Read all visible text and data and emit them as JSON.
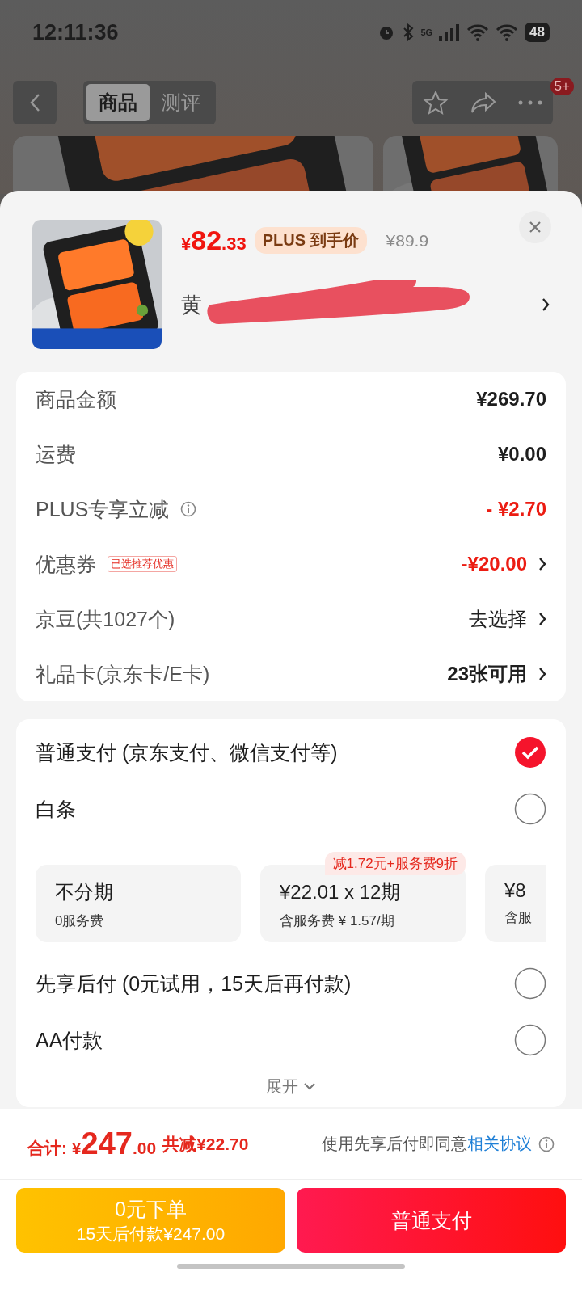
{
  "status_bar": {
    "time": "12:11:36",
    "network": "5G",
    "battery": "48"
  },
  "nav": {
    "tabs": [
      {
        "label": "商品",
        "selected": true
      },
      {
        "label": "测评",
        "selected": false
      }
    ],
    "badge": "5+"
  },
  "product": {
    "price_symbol": "¥",
    "price_int": "82",
    "price_dec": ".33",
    "plus_tag": "PLUS 到手价",
    "original_price": "¥89.9",
    "name": "黄"
  },
  "summary": [
    {
      "label": "商品金额",
      "value": "¥269.70",
      "kind": "amount",
      "arrow": false,
      "info": false
    },
    {
      "label": "运费",
      "value": "¥0.00",
      "kind": "amount",
      "arrow": false,
      "info": false
    },
    {
      "label": "PLUS专享立减",
      "value": "- ¥2.70",
      "kind": "discount",
      "arrow": false,
      "info": true
    },
    {
      "label": "优惠券",
      "tag": "已选推荐优惠",
      "value": "-¥20.00",
      "kind": "discount",
      "arrow": true,
      "info": false
    },
    {
      "label": "京豆(共1027个)",
      "value": "去选择",
      "kind": "action",
      "arrow": true,
      "info": false
    },
    {
      "label": "礼品卡(京东卡/E卡)",
      "value": "23张可用",
      "kind": "amount",
      "arrow": true,
      "info": false
    }
  ],
  "payment": {
    "options": [
      {
        "label": "普通支付 (京东支付、微信支付等)",
        "selected": true
      },
      {
        "label": "白条",
        "selected": false,
        "plans": [
          {
            "title": "不分期",
            "sub": "0服务费"
          },
          {
            "title": "¥22.01 x 12期",
            "sub": "含服务费 ¥ 1.57/期",
            "promo": "减1.72元+服务费9折"
          },
          {
            "title": "¥8",
            "sub": "含服"
          }
        ]
      },
      {
        "label": "先享后付 (0元试用，15天后再付款)",
        "selected": false
      },
      {
        "label": "AA付款",
        "selected": false
      }
    ],
    "expand": "展开"
  },
  "footer": {
    "total_label": "合计:",
    "total_symbol": "¥",
    "total_int": "247",
    "total_dec": ".00",
    "saved": "共减¥22.70",
    "agree": "使用先享后付即同意",
    "agree_link": "相关协议",
    "buttons": [
      {
        "kind": "later",
        "title": "0元下单",
        "sub": "15天后付款¥247.00"
      },
      {
        "kind": "pay",
        "title": "普通支付"
      }
    ]
  }
}
